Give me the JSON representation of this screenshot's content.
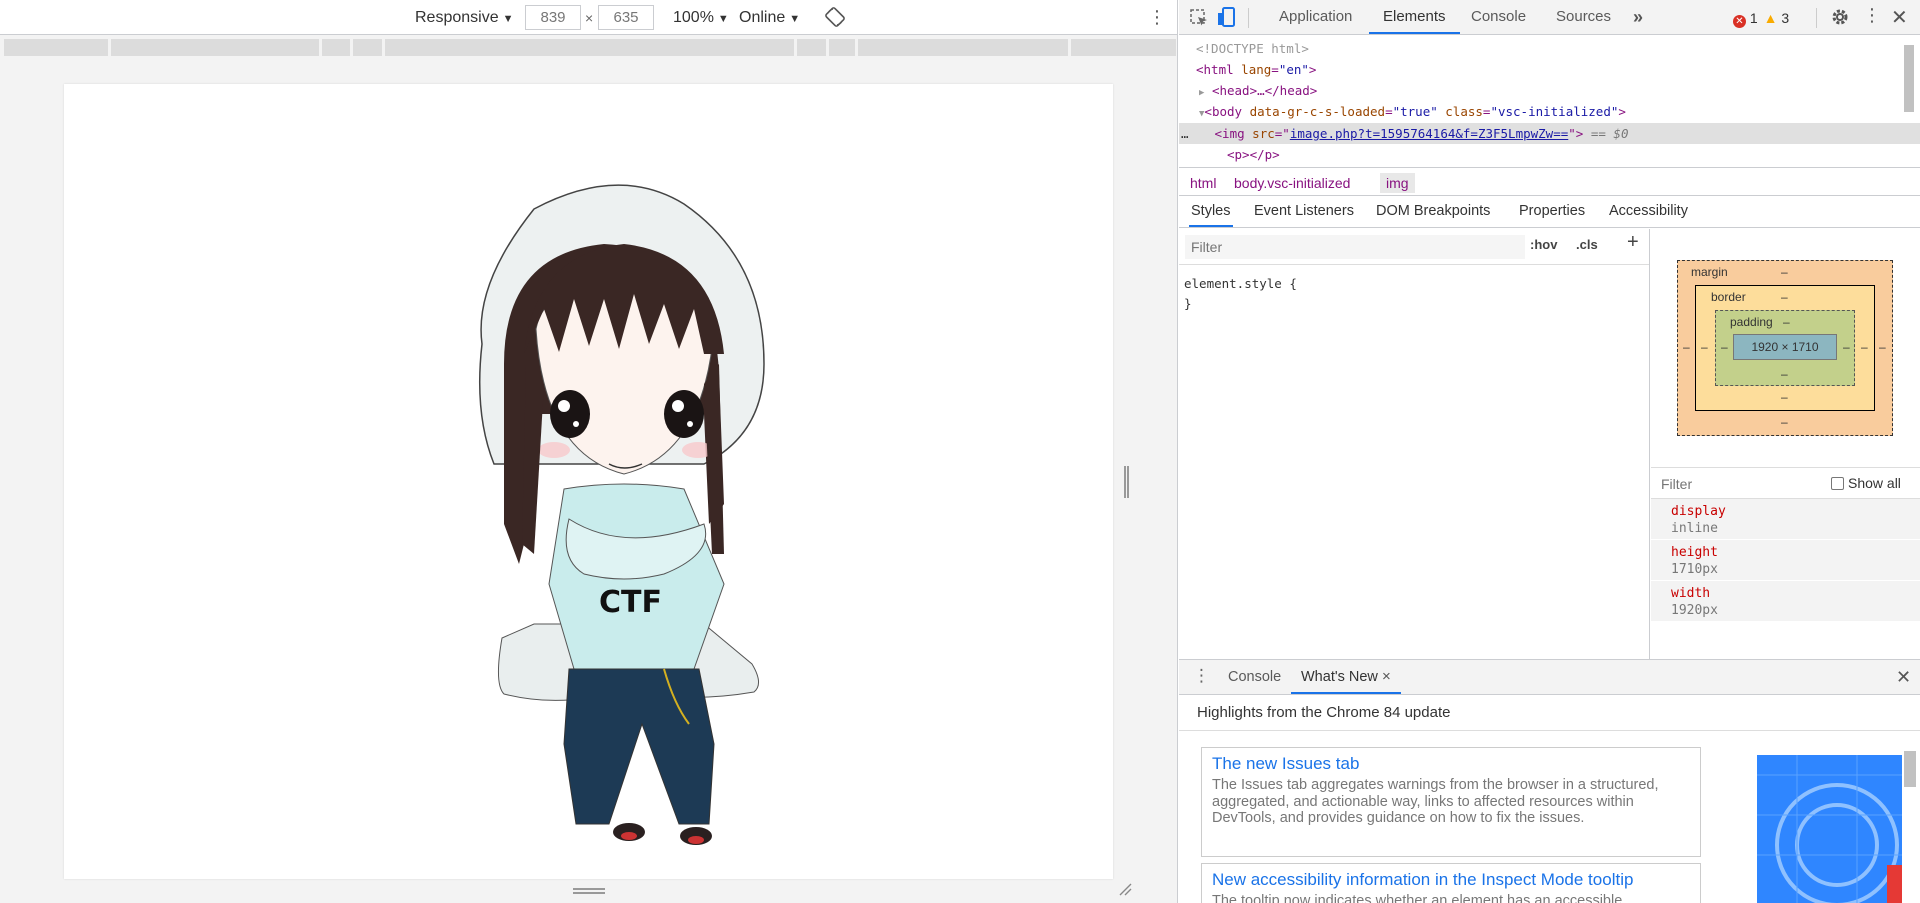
{
  "device_toolbar": {
    "device": "Responsive",
    "width": "839",
    "x": "×",
    "height": "635",
    "zoom": "100%",
    "throttle": "Online"
  },
  "page_image": {
    "shirt_text": "CTF"
  },
  "devtools": {
    "tabs": [
      "Application",
      "Elements",
      "Console",
      "Sources"
    ],
    "more_tabs": "»",
    "errors": "1",
    "warnings": "3",
    "tree": {
      "doctype": "<!DOCTYPE html>",
      "html_open": "<html",
      "html_attr": "lang",
      "html_val": "\"en\"",
      "html_close": ">",
      "head": "<head>…</head>",
      "body_open": "<body",
      "body_attr1": "data-gr-c-s-loaded",
      "body_val1": "\"true\"",
      "body_attr2": "class",
      "body_val2": "\"vsc-initialized\"",
      "body_close": ">",
      "img_open": "<img",
      "img_attr": "src",
      "img_val": "image.php?t=1595764164&f=Z3F5LmpwZw==",
      "img_close": ">",
      "img_ref": "== $0",
      "p": "<p></p>",
      "dots": "…"
    },
    "breadcrumbs": [
      "html",
      "body.vsc-initialized",
      "img"
    ],
    "subtabs": [
      "Styles",
      "Event Listeners",
      "DOM Breakpoints",
      "Properties",
      "Accessibility"
    ],
    "styles_filter_placeholder": "Filter",
    "hov": ":hov",
    "cls": ".cls",
    "plus": "+",
    "rule_open": "element.style {",
    "rule_close": "}",
    "box_model": {
      "margin": "margin",
      "border": "border",
      "padding": "padding",
      "dash": "–",
      "content": "1920 × 1710"
    },
    "computed_filter_placeholder": "Filter",
    "show_all": "Show all",
    "computed": [
      {
        "name": "display",
        "value": "inline"
      },
      {
        "name": "height",
        "value": "1710px"
      },
      {
        "name": "width",
        "value": "1920px"
      }
    ],
    "drawer": {
      "tabs": [
        "Console",
        "What's New"
      ],
      "close_tab": "×",
      "highlights": "Highlights from the Chrome 84 update",
      "cards": [
        {
          "title": "The new Issues tab",
          "desc": "The Issues tab aggregates warnings from the browser in a structured, aggregated, and actionable way, links to affected resources within DevTools, and provides guidance on how to fix the issues."
        },
        {
          "title": "New accessibility information in the Inspect Mode tooltip",
          "desc": "The tooltip now indicates whether an element has an accessible"
        }
      ]
    }
  }
}
